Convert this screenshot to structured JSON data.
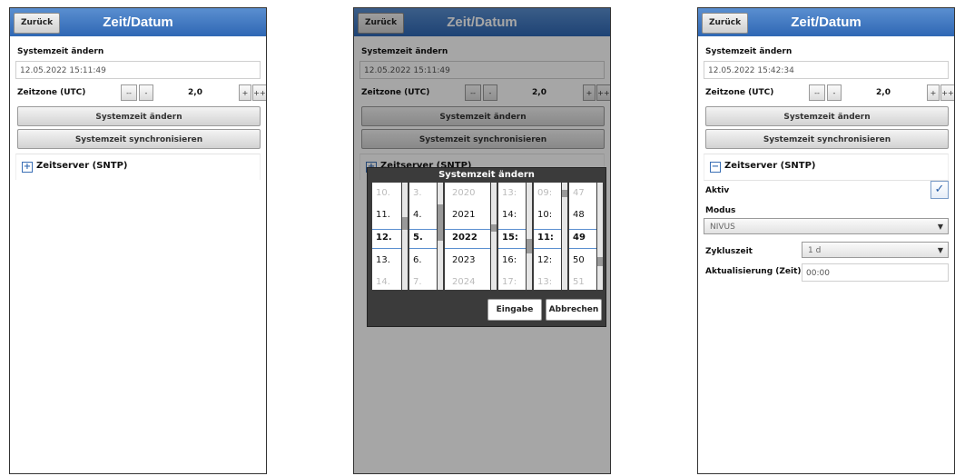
{
  "common": {
    "back_label": "Zurück",
    "title": "Zeit/Datum",
    "sys_time_label": "Systemzeit ändern",
    "timezone_label": "Zeitzone (UTC)",
    "tz_minus2": "--",
    "tz_minus1": "-",
    "tz_value": "2,0",
    "tz_plus1": "+",
    "tz_plus2": "++",
    "change_btn": "Systemzeit ändern",
    "sync_btn": "Systemzeit synchronisieren",
    "sntp_label": "Zeitserver (SNTP)"
  },
  "panel1": {
    "sys_time_value": "12.05.2022 15:11:49",
    "sntp_toggle": "+"
  },
  "panel2": {
    "sys_time_value": "12.05.2022 15:11:49",
    "sntp_toggle": "+",
    "dialog": {
      "title": "Systemzeit ändern",
      "day": [
        "10.",
        "11.",
        "12.",
        "13.",
        "14."
      ],
      "month": [
        "3.",
        "4.",
        "5.",
        "6.",
        "7."
      ],
      "year": [
        "2020",
        "2021",
        "2022",
        "2023",
        "2024"
      ],
      "hour": [
        "13:",
        "14:",
        "15:",
        "16:",
        "17:"
      ],
      "minute": [
        "09:",
        "10:",
        "11:",
        "12:",
        "13:"
      ],
      "second": [
        "47",
        "48",
        "49",
        "50",
        "51"
      ],
      "ok_label": "Eingabe",
      "cancel_label": "Abbrechen"
    }
  },
  "panel3": {
    "sys_time_value": "12.05.2022 15:42:34",
    "sntp_toggle": "−",
    "active_label": "Aktiv",
    "active_checked": true,
    "check_glyph": "✓",
    "mode_label": "Modus",
    "mode_value": "NIVUS",
    "cycle_label": "Zykluszeit",
    "cycle_value": "1 d",
    "update_label": "Aktualisierung (Zeit)",
    "update_value": "00:00"
  }
}
